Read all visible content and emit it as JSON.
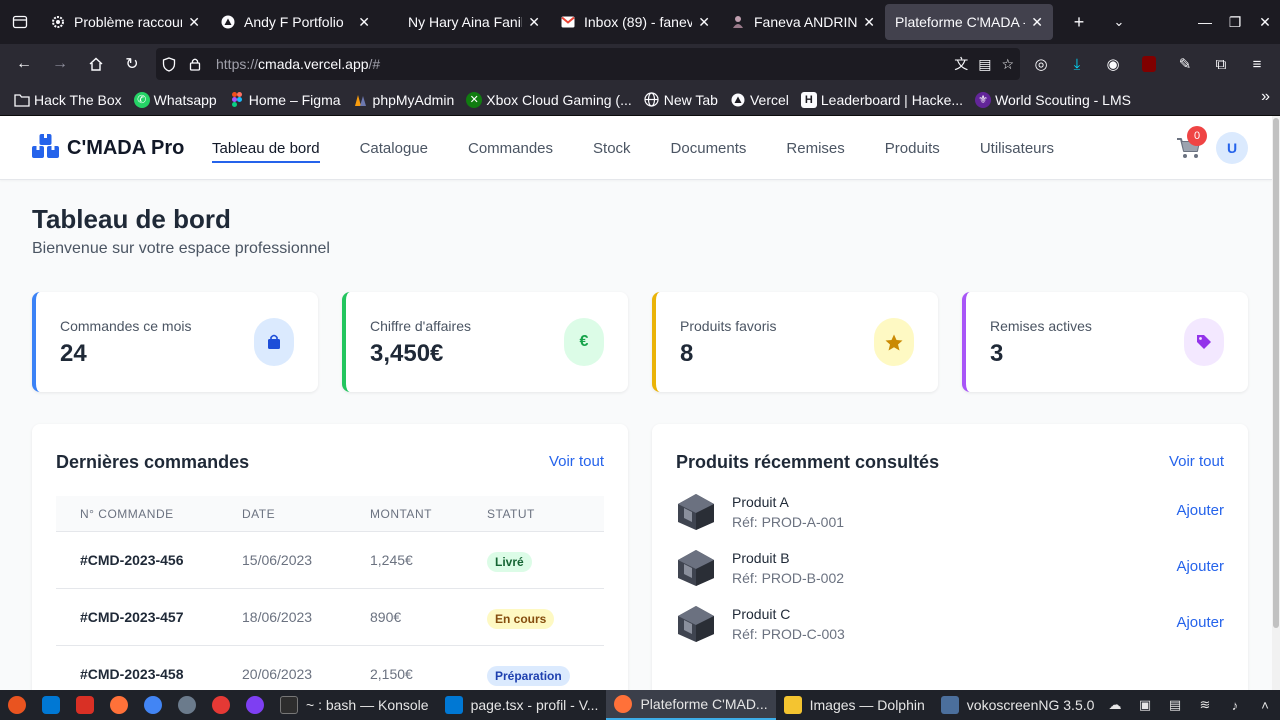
{
  "browser": {
    "tabs": [
      {
        "title": "Problème raccour",
        "favicon": "gear-icon",
        "active": false
      },
      {
        "title": "Andy F Portfolio",
        "favicon": "vercel-triangle-icon",
        "active": false
      },
      {
        "title": "Ny Hary Aina Fanilo",
        "favicon": "",
        "active": false
      },
      {
        "title": "Inbox (89) - fanev",
        "favicon": "gmail-icon",
        "active": false
      },
      {
        "title": "Faneva ANDRINAI",
        "favicon": "profile-icon",
        "active": false
      },
      {
        "title": "Plateforme C'MADA -",
        "favicon": "",
        "active": true
      }
    ],
    "url": {
      "scheme": "https://",
      "host": "cmada.vercel.app",
      "path": "/#"
    },
    "bookmarks": [
      {
        "label": "Hack The Box",
        "icon": "folder-icon"
      },
      {
        "label": "Whatsapp",
        "icon": "whatsapp-icon"
      },
      {
        "label": "Home – Figma",
        "icon": "figma-icon"
      },
      {
        "label": "phpMyAdmin",
        "icon": "phpmyadmin-icon"
      },
      {
        "label": "Xbox Cloud Gaming (...",
        "icon": "xbox-icon"
      },
      {
        "label": "New Tab",
        "icon": "globe-icon"
      },
      {
        "label": "Vercel",
        "icon": "vercel-icon"
      },
      {
        "label": "Leaderboard | Hacke...",
        "icon": "hackerrank-icon"
      },
      {
        "label": "World Scouting - LMS",
        "icon": "scouting-icon"
      }
    ]
  },
  "app": {
    "brand": "C'MADA Pro",
    "nav": [
      "Tableau de bord",
      "Catalogue",
      "Commandes",
      "Stock",
      "Documents",
      "Remises",
      "Produits",
      "Utilisateurs"
    ],
    "cart_count": "0",
    "avatar_initial": "U",
    "colors": {
      "accent": "#2563eb"
    }
  },
  "page": {
    "title": "Tableau de bord",
    "subtitle": "Bienvenue sur votre espace professionnel"
  },
  "stats": [
    {
      "label": "Commandes ce mois",
      "value": "24",
      "icon": "shopping-bag-icon",
      "color": "#3b82f6"
    },
    {
      "label": "Chiffre d'affaires",
      "value": "3,450€",
      "icon": "euro-icon",
      "glyph": "€",
      "color": "#22c55e"
    },
    {
      "label": "Produits favoris",
      "value": "8",
      "icon": "star-icon",
      "color": "#eab308"
    },
    {
      "label": "Remises actives",
      "value": "3",
      "icon": "tag-icon",
      "color": "#a855f7"
    }
  ],
  "orders": {
    "title": "Dernières commandes",
    "link": "Voir tout",
    "headers": [
      "N° COMMANDE",
      "DATE",
      "MONTANT",
      "STATUT"
    ],
    "rows": [
      {
        "id": "#CMD-2023-456",
        "date": "15/06/2023",
        "amount": "1,245€",
        "status": "Livré"
      },
      {
        "id": "#CMD-2023-457",
        "date": "18/06/2023",
        "amount": "890€",
        "status": "En cours"
      },
      {
        "id": "#CMD-2023-458",
        "date": "20/06/2023",
        "amount": "2,150€",
        "status": "Préparation"
      }
    ]
  },
  "recent": {
    "title": "Produits récemment consultés",
    "link": "Voir tout",
    "items": [
      {
        "name": "Produit A",
        "ref": "Réf: PROD-A-001",
        "action": "Ajouter"
      },
      {
        "name": "Produit B",
        "ref": "Réf: PROD-B-002",
        "action": "Ajouter"
      },
      {
        "name": "Produit C",
        "ref": "Réf: PROD-C-003",
        "action": "Ajouter"
      }
    ]
  },
  "taskbar": {
    "tasks": [
      {
        "label": "~ : bash — Konsole",
        "active": false
      },
      {
        "label": "page.tsx - profil - V...",
        "active": false
      },
      {
        "label": "Plateforme C'MAD...",
        "active": true
      },
      {
        "label": "Images — Dolphin",
        "active": false
      },
      {
        "label": "vokoscreenNG 3.5.0",
        "active": false
      }
    ]
  }
}
